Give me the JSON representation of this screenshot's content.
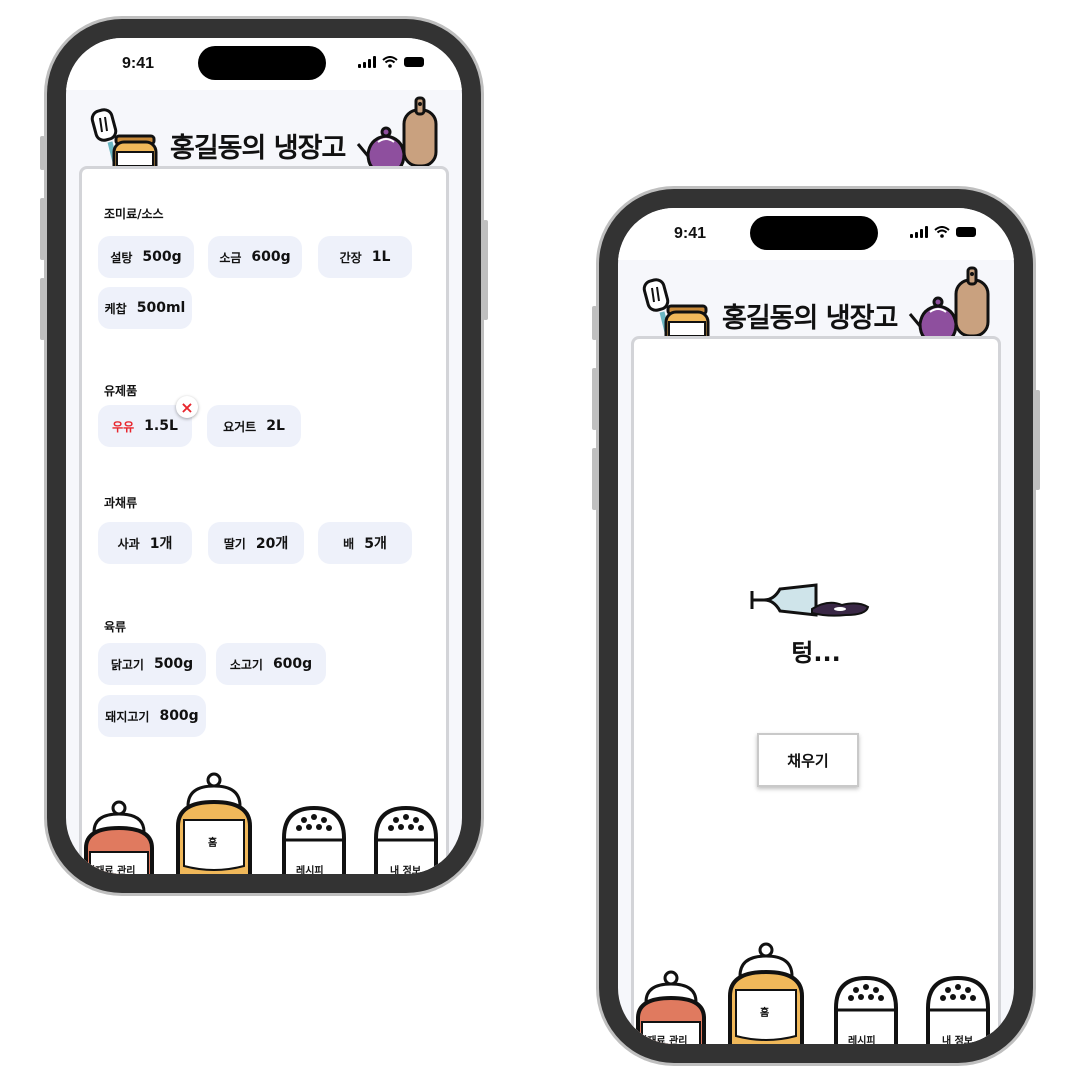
{
  "status_bar": {
    "time": "9:41"
  },
  "header": {
    "title": "홍길동의 냉장고"
  },
  "fridge": {
    "categories": [
      {
        "name": "조미료/소스",
        "items": [
          {
            "name": "설탕",
            "qty": "500g"
          },
          {
            "name": "소금",
            "qty": "600g"
          },
          {
            "name": "간장",
            "qty": "1L"
          },
          {
            "name": "케찹",
            "qty": "500ml"
          }
        ]
      },
      {
        "name": "유제품",
        "items": [
          {
            "name": "우유",
            "qty": "1.5L"
          },
          {
            "name": "요거트",
            "qty": "2L"
          }
        ]
      },
      {
        "name": "과채류",
        "items": [
          {
            "name": "사과",
            "qty": "1개"
          },
          {
            "name": "딸기",
            "qty": "20개"
          },
          {
            "name": "배",
            "qty": "5개"
          }
        ]
      },
      {
        "name": "육류",
        "items": [
          {
            "name": "닭고기",
            "qty": "500g"
          },
          {
            "name": "소고기",
            "qty": "600g"
          },
          {
            "name": "돼지고기",
            "qty": "800g"
          }
        ]
      }
    ],
    "remove_icon": "×"
  },
  "empty_state": {
    "message": "텅...",
    "fill_button": "채우기"
  },
  "nav": {
    "items": [
      "식재료 관리",
      "홈",
      "레시피",
      "내 정보"
    ],
    "colors": {
      "manage": "#e07a5f",
      "home": "#f0b85a",
      "recipe": "#ffffff",
      "profile": "#ffffff"
    }
  },
  "colors": {
    "chip_bg": "#eef1fa",
    "alert": "#e8262d",
    "frame": "#333333"
  }
}
